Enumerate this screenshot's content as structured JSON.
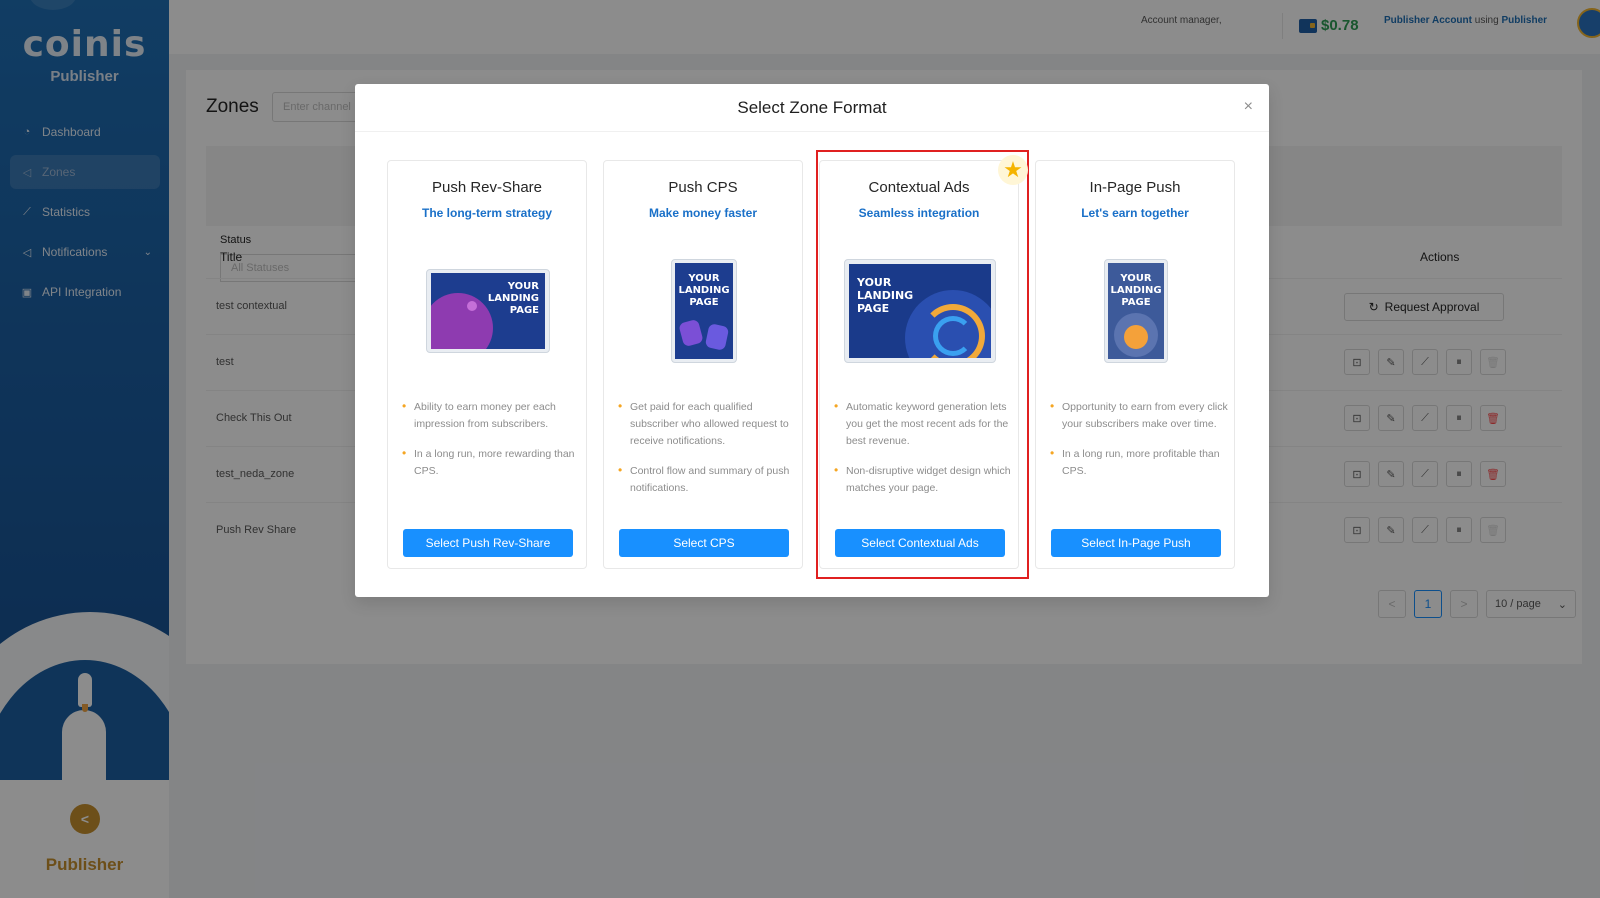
{
  "sidebar": {
    "logo": "coinis",
    "brand_sub": "Publisher",
    "items": [
      {
        "label": "Dashboard",
        "icon": "dashboard-icon"
      },
      {
        "label": "Zones",
        "icon": "megaphone-icon"
      },
      {
        "label": "Statistics",
        "icon": "line-chart-icon"
      },
      {
        "label": "Notifications",
        "icon": "bell-icon"
      },
      {
        "label": "API Integration",
        "icon": "code-icon"
      }
    ],
    "footer_label": "Publisher",
    "collapse_glyph": "<"
  },
  "header": {
    "account_manager": "Account manager,",
    "balance": "$0.78",
    "publisher_account": "Publisher Account",
    "using": "using",
    "publisher": "Publisher"
  },
  "main": {
    "title": "Zones",
    "search_placeholder": "Enter channel",
    "status_label": "Status",
    "status_value": "All Statuses",
    "col_title": "Title",
    "col_actions": "Actions",
    "rows": [
      {
        "title": "test contextual"
      },
      {
        "title": "test"
      },
      {
        "title": "Check This Out"
      },
      {
        "title": "test_neda_zone"
      },
      {
        "title": "Push Rev Share"
      }
    ],
    "request_approval": "Request Approval",
    "pagination": {
      "prev": "<",
      "current": "1",
      "next": ">",
      "page_size": "10 / page"
    }
  },
  "modal": {
    "title": "Select Zone Format",
    "close": "×",
    "landing_text": "YOUR LANDING PAGE",
    "cards": [
      {
        "title": "Push Rev-Share",
        "subtitle": "The long-term strategy",
        "bullets": [
          "Ability to earn money per each impression from subscribers.",
          "In a long run, more rewarding than CPS."
        ],
        "button": "Select Push Rev-Share"
      },
      {
        "title": "Push CPS",
        "subtitle": "Make money faster",
        "bullets": [
          "Get paid for each qualified subscriber who allowed request to receive notifications.",
          "Control flow and summary of push notifications."
        ],
        "button": "Select CPS"
      },
      {
        "title": "Contextual Ads",
        "subtitle": "Seamless integration",
        "bullets": [
          "Automatic keyword generation lets you get the most recent ads for the best revenue.",
          "Non-disruptive widget design which matches your page."
        ],
        "button": "Select Contextual Ads"
      },
      {
        "title": "In-Page Push",
        "subtitle": "Let's earn together",
        "bullets": [
          "Opportunity to earn from every click your subscribers make over time.",
          "In a long run, more profitable than CPS."
        ],
        "button": "Select In-Page Push"
      }
    ]
  },
  "colors": {
    "sidebar": "#1c5fa3",
    "primary_button": "#1890ff",
    "subtitle": "#1a70c8",
    "highlight": "#e02020",
    "balance": "#2f9d55",
    "accent_gold": "#c7902e"
  }
}
